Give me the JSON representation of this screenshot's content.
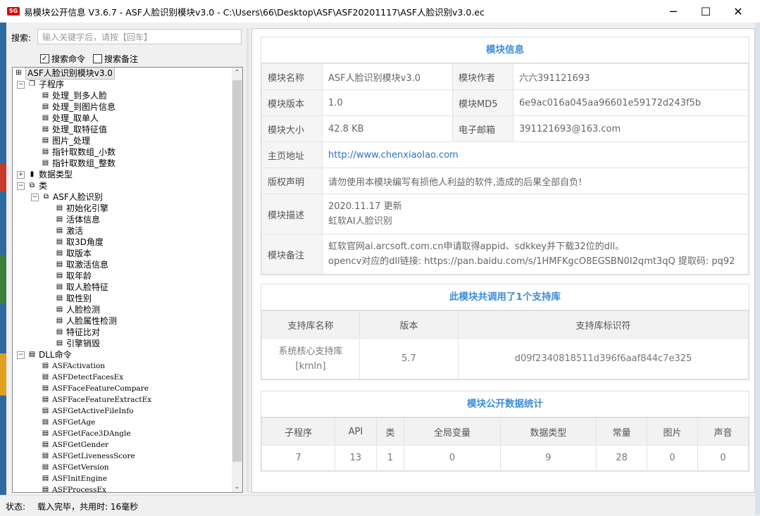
{
  "window": {
    "icon_text": "SG",
    "title": "易模块公开信息 V3.6.7 - ASF人脸识别模块v3.0 - C:\\Users\\66\\Desktop\\ASF\\ASF20201117\\ASF人脸识别v3.0.ec",
    "min": "─",
    "max": "☐",
    "close": "✕"
  },
  "search": {
    "label": "搜索:",
    "placeholder": "输入关键字后，请按【回车】",
    "opt_command": "搜索命令",
    "opt_command_checked": true,
    "opt_note": "搜索备注",
    "opt_note_checked": false
  },
  "tree": {
    "root": "ASF人脸识别模块v3.0",
    "subprograms_label": "子程序",
    "subprograms": [
      "处理_到多人脸",
      "处理_到图片信息",
      "处理_取单人",
      "处理_取特征值",
      "图片_处理",
      "指针取数组_小数",
      "指针取数组_整数"
    ],
    "datatypes_label": "数据类型",
    "class_label": "类",
    "class_name": "ASF人脸识别",
    "class_methods": [
      "初始化引擎",
      "活体信息",
      "激活",
      "取3D角度",
      "取版本",
      "取激活信息",
      "取年龄",
      "取人脸特征",
      "取性别",
      "人脸检测",
      "人脸属性检测",
      "特征比对",
      "引擎销毁"
    ],
    "dll_label": "DLL命令",
    "dll_commands": [
      "ASFActivation",
      "ASFDetectFacesEx",
      "ASFFaceFeatureCompare",
      "ASFFaceFeatureExtractEx",
      "ASFGetActiveFileInfo",
      "ASFGetAge",
      "ASFGetFace3DAngle",
      "ASFGetGender",
      "ASFGetLivenessScore",
      "ASFGetVersion",
      "ASFInitEngine",
      "ASFProcessEx"
    ]
  },
  "status": {
    "label": "状态:",
    "text": "载入完毕，共用时: 16毫秒"
  },
  "module_info": {
    "title": "模块信息",
    "name_label": "模块名称",
    "name": "ASF人脸识别模块v3.0",
    "author_label": "模块作者",
    "author": "六六391121693",
    "version_label": "模块版本",
    "version": "1.0",
    "md5_label": "模块MD5",
    "md5": "6e9ac016a045aa96601e59172d243f5b",
    "size_label": "模块大小",
    "size": "42.8 KB",
    "email_label": "电子邮箱",
    "email": "391121693@163.com",
    "homepage_label": "主页地址",
    "homepage": "http://www.chenxiaolao.com",
    "copyright_label": "版权声明",
    "copyright": "请勿使用本模块编写有损他人利益的软件,造成的后果全部自负!",
    "desc_label": "模块描述",
    "desc_line1": "2020.11.17 更新",
    "desc_line2": "虹软AI人脸识别",
    "note_label": "模块备注",
    "note_line1": "虹软官网ai.arcsoft.com.cn申请取得appid、sdkkey并下载32位的dll。",
    "note_line2": "opencv对应的dll链接: https://pan.baidu.com/s/1HMFKgcO8EGSBN0I2qmt3qQ 提取码: pq92"
  },
  "support_libs": {
    "title": "此模块共调用了1个支持库",
    "headers": [
      "支持库名称",
      "版本",
      "支持库标识符"
    ],
    "row": {
      "name": "系统核心支持库[krnln]",
      "version": "5.7",
      "id": "d09f2340818511d396f6aaf844c7e325"
    }
  },
  "stats": {
    "title": "模块公开数据统计",
    "headers": [
      "子程序",
      "API",
      "类",
      "全局变量",
      "数据类型",
      "常量",
      "图片",
      "声音"
    ],
    "values": [
      "7",
      "13",
      "1",
      "0",
      "9",
      "28",
      "0",
      "0"
    ]
  }
}
